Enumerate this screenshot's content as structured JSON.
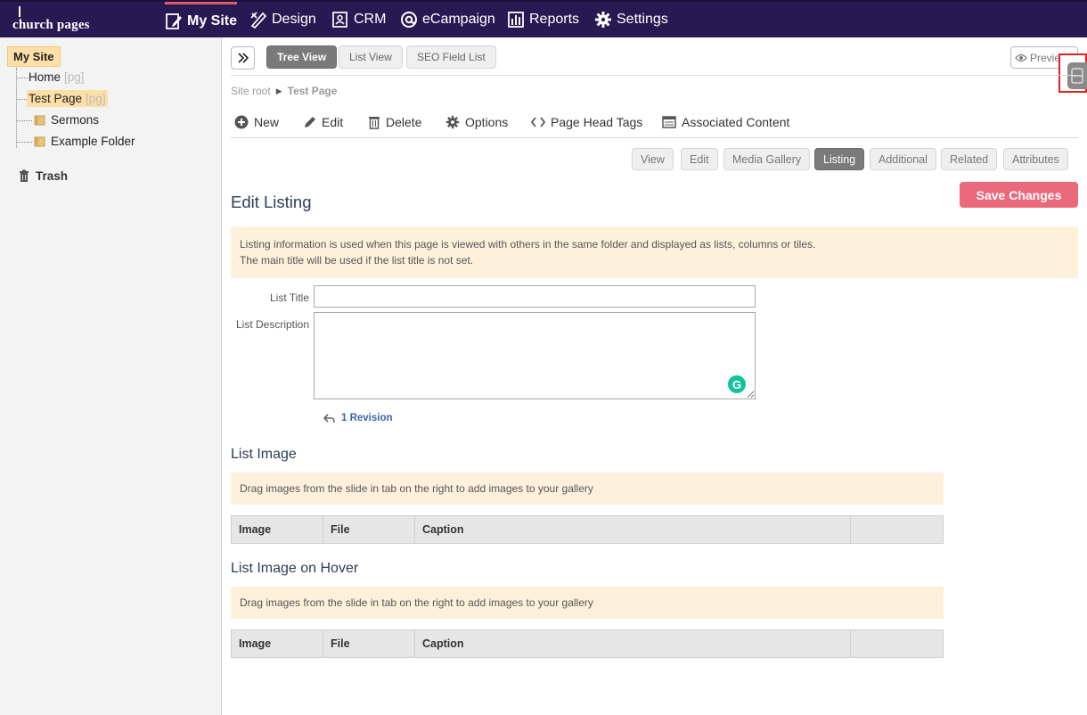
{
  "brand": {
    "logo_text": "church pages"
  },
  "topnav": {
    "items": [
      {
        "label": "My Site",
        "icon": "edit-page-icon"
      },
      {
        "label": "Design",
        "icon": "design-tools-icon"
      },
      {
        "label": "CRM",
        "icon": "contacts-icon"
      },
      {
        "label": "eCampaign",
        "icon": "at-sign-icon"
      },
      {
        "label": "Reports",
        "icon": "bar-chart-icon"
      },
      {
        "label": "Settings",
        "icon": "gear-icon"
      }
    ],
    "active": "My Site"
  },
  "sidebar": {
    "root": "My Site",
    "nodes": [
      {
        "label": "Home",
        "badge": "[pg]"
      },
      {
        "label": "Test Page",
        "badge": "[pg]"
      },
      {
        "label": "Sermons"
      },
      {
        "label": "Example Folder"
      }
    ],
    "trash": "Trash"
  },
  "toolbar": {
    "view_tabs": [
      "Tree View",
      "List View",
      "SEO Field List"
    ],
    "active_view": "Tree View",
    "preview_label": "Preview"
  },
  "breadcrumb": {
    "root": "Site root",
    "current": "Test Page"
  },
  "actions": [
    "New",
    "Edit",
    "Delete",
    "Options",
    "Page Head Tags",
    "Associated Content"
  ],
  "subtabs": [
    "View",
    "Edit",
    "Media Gallery",
    "Listing",
    "Additional",
    "Related",
    "Attributes"
  ],
  "active_subtab": "Listing",
  "form": {
    "title": "Edit Listing",
    "save_label": "Save Changes",
    "info_line1": "Listing information is used when this page is viewed with others in the same folder and displayed as lists, columns or tiles.",
    "info_line2": "The main title will be used if the list title is not set.",
    "list_title_label": "List Title",
    "list_title_value": "",
    "list_desc_label": "List Description",
    "list_desc_value": "",
    "revision": "1 Revision"
  },
  "list_image": {
    "heading": "List Image",
    "note": "Drag images from the slide in tab on the right to add images to your gallery",
    "columns": [
      "Image",
      "File",
      "Caption",
      ""
    ]
  },
  "list_image_hover": {
    "heading": "List Image on Hover",
    "note": "Drag images from the slide in tab on the right to add images to your gallery",
    "columns": [
      "Image",
      "File",
      "Caption",
      ""
    ]
  },
  "colors": {
    "nav_bg": "#271a52",
    "accent": "#e0596b",
    "save": "#ea6a7b",
    "highlight": "#fde0a8",
    "note_bg": "#fdf1dc"
  }
}
